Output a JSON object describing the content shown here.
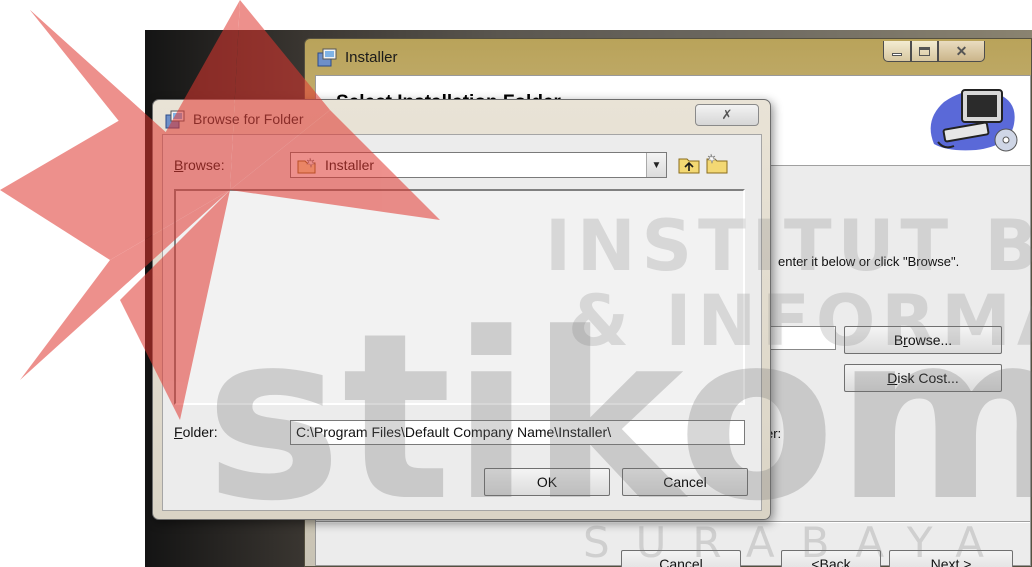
{
  "installer": {
    "title": "Installer",
    "heading": "Select Installation Folder",
    "description": "enter it below or click \"Browse\".",
    "user_label": "er:",
    "buttons": {
      "browse_prefix": "B",
      "browse_accel": "r",
      "browse_suffix": "owse...",
      "diskcost_accel": "D",
      "diskcost_suffix": "isk Cost...",
      "cancel": "Cancel",
      "back_prefix": "< ",
      "back_accel": "B",
      "back_suffix": "ack",
      "next_accel": "N",
      "next_suffix": "ext >"
    }
  },
  "browse_dialog": {
    "title": "Browse for Folder",
    "close_glyph": "✗",
    "browse_label_accel": "B",
    "browse_label_suffix": "rowse:",
    "combo_value": "Installer",
    "combo_arrow": "▼",
    "folder_label_accel": "F",
    "folder_label_suffix": "older:",
    "folder_value": "C:\\Program Files\\Default Company Name\\Installer\\",
    "ok_label": "OK",
    "cancel_label": "Cancel"
  },
  "window_controls": {
    "close_glyph": "✕"
  },
  "watermark": {
    "line1": "INSTITUT BISNIS",
    "line2": "& INFORMATIKA",
    "brand": "stikom",
    "city": "SURABAYA"
  },
  "colors": {
    "accent_red": "#e0362f",
    "installer_title_gold": "#c9b277"
  }
}
